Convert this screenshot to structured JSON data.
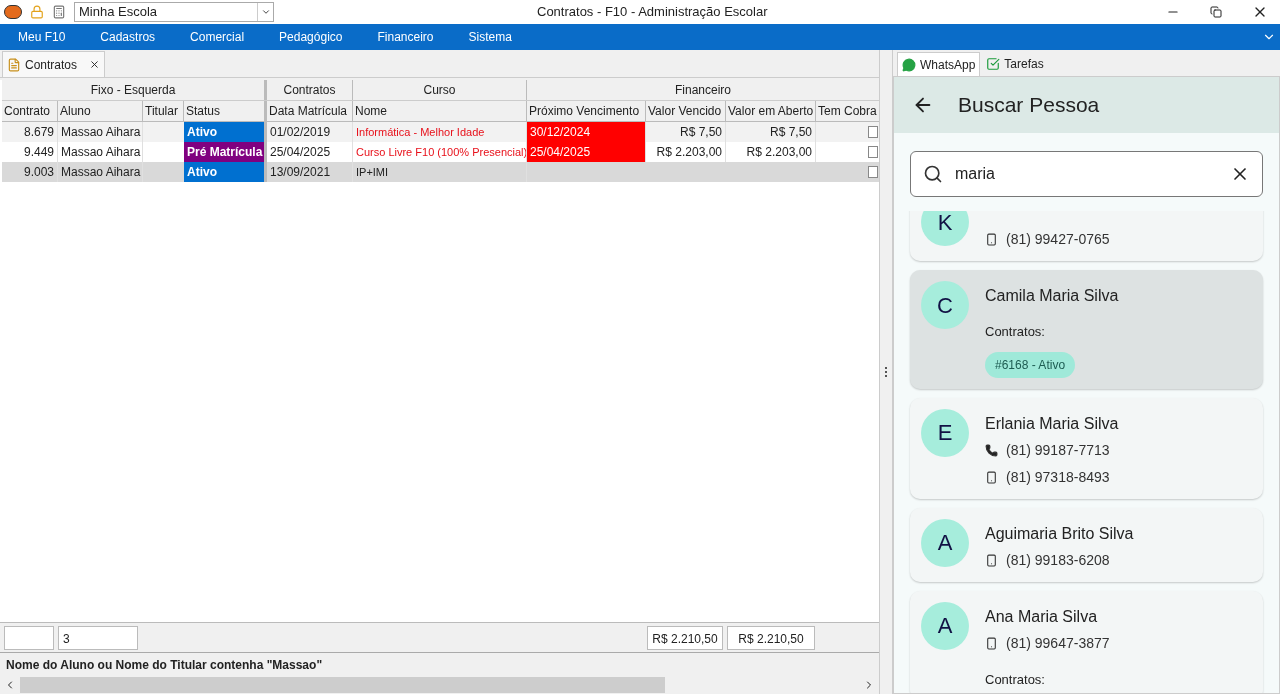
{
  "title_bar": {
    "school_select": "Minha Escola",
    "title": "Contratos - F10 - Administração Escolar"
  },
  "menu": [
    "Meu F10",
    "Cadastros",
    "Comercial",
    "Pedagógico",
    "Financeiro",
    "Sistema"
  ],
  "doc_tabs": [
    {
      "label": "Contratos",
      "selected": true
    }
  ],
  "grid": {
    "groups": [
      "Fixo - Esquerda",
      "Contratos",
      "Curso",
      "Financeiro"
    ],
    "columns": [
      "Contrato",
      "Aluno",
      "Titular",
      "Status",
      "Data Matrícula",
      "Nome",
      "Próximo Vencimento",
      "Valor Vencido",
      "Valor em Aberto",
      "Tem Cobra"
    ],
    "rows": [
      {
        "contrato": "8.679",
        "aluno": "Massao Aihara",
        "status": "Ativo",
        "color": "#0070d0",
        "data": "01/02/2019",
        "curso": "Informática - Melhor Idade",
        "vencimento": "30/12/2024",
        "overdue": true,
        "valor_vencido": "R$ 7,50",
        "valor_aberto": "R$ 7,50",
        "tem_cobranca": false,
        "selected": false
      },
      {
        "contrato": "9.449",
        "aluno": "Massao Aihara",
        "status": "Pré Matrícula",
        "color": "#800080",
        "data": "25/04/2025",
        "curso": "Curso Livre F10 (100% Presencial)",
        "vencimento": "25/04/2025",
        "overdue": true,
        "valor_vencido": "R$ 2.203,00",
        "valor_aberto": "R$ 2.203,00",
        "tem_cobranca": false,
        "selected": false
      },
      {
        "contrato": "9.003",
        "aluno": "Massao Aihara",
        "status": "Ativo",
        "color": "#0070d0",
        "data": "13/09/2021",
        "curso": "IP+IMI",
        "overdue": false,
        "tem_cobranca": false,
        "selected": true
      }
    ],
    "totals": {
      "count": "3",
      "valor_vencido": "R$ 2.210,50",
      "valor_aberto": "R$ 2.210,50"
    },
    "filter": "Nome do Aluno ou Nome do Titular contenha \"Massao\""
  },
  "side_tabs": [
    {
      "label": "WhatsApp",
      "kind": "whatsapp",
      "selected": true
    },
    {
      "label": "Tarefas",
      "kind": "tasks",
      "selected": false
    }
  ],
  "panel": {
    "title": "Buscar Pessoa",
    "search": "maria",
    "people": [
      {
        "initial": "K",
        "phones": [
          {
            "kind": "mobile",
            "number": "(81) 99427-0765"
          }
        ],
        "selected": false
      },
      {
        "initial": "C",
        "name": "Camila Maria Silva",
        "contracts_label": "Contratos:",
        "contracts": [
          "#6168 - Ativo"
        ],
        "selected": true
      },
      {
        "initial": "E",
        "name": "Erlania Maria Silva",
        "phones": [
          {
            "kind": "phone",
            "number": "(81) 99187-7713"
          },
          {
            "kind": "mobile",
            "number": "(81) 97318-8493"
          }
        ],
        "selected": false
      },
      {
        "initial": "A",
        "name": "Aguimaria Brito Silva",
        "phones": [
          {
            "kind": "mobile",
            "number": "(81) 99183-6208"
          }
        ],
        "selected": false
      },
      {
        "initial": "A",
        "name": "Ana Maria Silva",
        "phones": [
          {
            "kind": "mobile",
            "number": "(81) 99647-3877"
          }
        ],
        "contracts_label": "Contratos:",
        "selected": false
      }
    ]
  }
}
